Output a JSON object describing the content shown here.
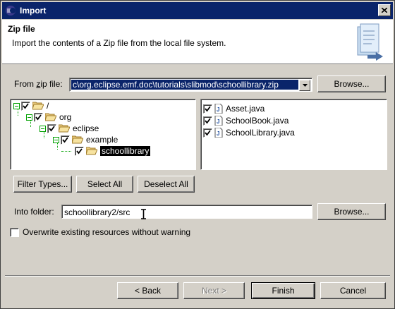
{
  "window": {
    "title": "Import"
  },
  "banner": {
    "title": "Zip file",
    "description": "Import the contents of a Zip file from the local file system."
  },
  "zip": {
    "label_prefix": "From ",
    "label_accel": "z",
    "label_suffix": "ip file:",
    "value": "c\\org.eclipse.emf.doc\\tutorials\\slibmod\\schoollibrary.zip",
    "browse_label": "Browse..."
  },
  "tree": {
    "items": [
      {
        "label": "/",
        "checked": true
      },
      {
        "label": "org",
        "checked": true
      },
      {
        "label": "eclipse",
        "checked": true
      },
      {
        "label": "example",
        "checked": true
      },
      {
        "label": "schoollibrary",
        "checked": true,
        "selected": true
      }
    ]
  },
  "files": {
    "items": [
      {
        "label": "Asset.java",
        "checked": true
      },
      {
        "label": "SchoolBook.java",
        "checked": true
      },
      {
        "label": "SchoolLibrary.java",
        "checked": true
      }
    ]
  },
  "buttons": {
    "filter_types": "Filter Types...",
    "select_all": "Select All",
    "deselect_all": "Deselect All"
  },
  "folder": {
    "label": "Into folder:",
    "value": "schoollibrary2/src",
    "browse_label": "Browse..."
  },
  "overwrite": {
    "label": "Overwrite existing resources without warning",
    "checked": false
  },
  "footer": {
    "back": "< Back",
    "next": "Next >",
    "finish": "Finish",
    "cancel": "Cancel"
  },
  "colors": {
    "title_bar": "#0a246a",
    "face": "#d4d0c8",
    "tree_lines": "#00a000"
  }
}
